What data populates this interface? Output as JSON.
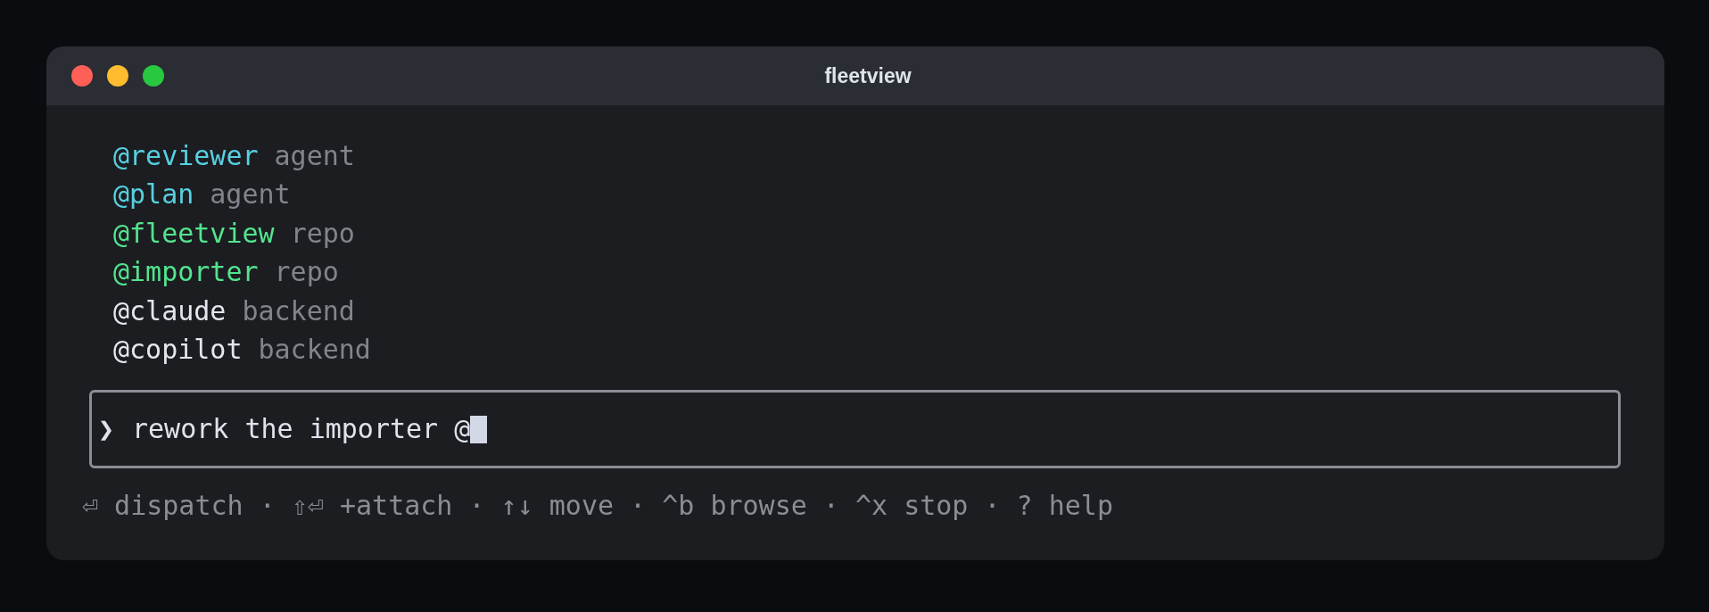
{
  "window": {
    "title": "fleetview"
  },
  "suggestions": [
    {
      "handle": "@reviewer",
      "category": "agent",
      "color": "#56d0e0"
    },
    {
      "handle": "@plan",
      "category": "agent",
      "color": "#56d0e0"
    },
    {
      "handle": "@fleetview",
      "category": "repo",
      "color": "#52e48e"
    },
    {
      "handle": "@importer",
      "category": "repo",
      "color": "#52e48e"
    },
    {
      "handle": "@claude",
      "category": "backend",
      "color": "#e2e6ef"
    },
    {
      "handle": "@copilot",
      "category": "backend",
      "color": "#e2e6ef"
    }
  ],
  "input": {
    "prompt": "❯",
    "value": "rework the importer @",
    "focused": true
  },
  "status_bar": {
    "hints": "⏎ dispatch · ⇧⏎ +attach · ↑↓ move · ^b browse · ^x stop · ? help"
  }
}
